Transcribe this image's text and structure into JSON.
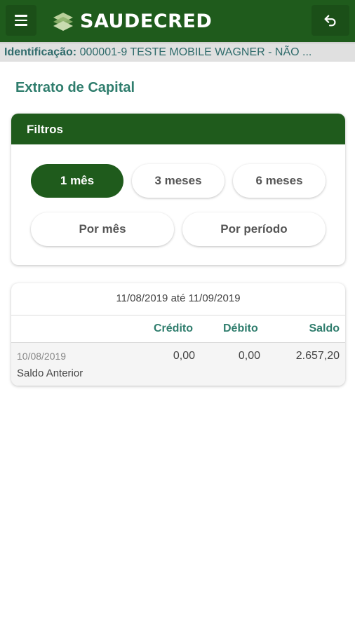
{
  "app": {
    "brand": "SAUDECRED",
    "brand_color": "#1f5b1c",
    "accent_text_color": "#2f7d6d"
  },
  "icons": {
    "menu": "hamburger-menu-icon",
    "back": "undo-arrow-icon",
    "logo": "saudecred-logo-icon"
  },
  "identification": {
    "label": "Identificação:",
    "value": "000001-9 TESTE MOBILE WAGNER - NÃO ..."
  },
  "page": {
    "title": "Extrato de Capital"
  },
  "filters": {
    "title": "Filtros",
    "options": [
      {
        "label": "1 mês",
        "active": true
      },
      {
        "label": "3 meses",
        "active": false
      },
      {
        "label": "6 meses",
        "active": false
      },
      {
        "label": "Por mês",
        "active": false
      },
      {
        "label": "Por período",
        "active": false
      }
    ]
  },
  "statement": {
    "range": "11/08/2019 até 11/09/2019",
    "columns": [
      "Crédito",
      "Débito",
      "Saldo"
    ],
    "rows": [
      {
        "date": "10/08/2019",
        "description": "Saldo Anterior",
        "credit": "0,00",
        "debit": "0,00",
        "balance": "2.657,20"
      }
    ]
  }
}
